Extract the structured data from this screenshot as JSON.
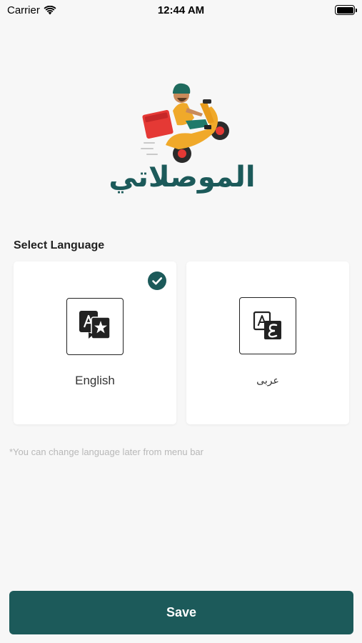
{
  "status_bar": {
    "carrier": "Carrier",
    "time": "12:44 AM"
  },
  "brand": {
    "name": "الموصلاتي"
  },
  "language": {
    "section_label": "Select Language",
    "options": [
      {
        "label": "English",
        "icon": "translate-a-star-icon",
        "selected": true
      },
      {
        "label": "عربى",
        "icon": "translate-a-ain-icon",
        "selected": false
      }
    ]
  },
  "hint": "*You can change language later from menu bar",
  "save_label": "Save",
  "colors": {
    "accent": "#1c5a5a",
    "background": "#f7f7f7",
    "hint": "#b8b8b8"
  }
}
